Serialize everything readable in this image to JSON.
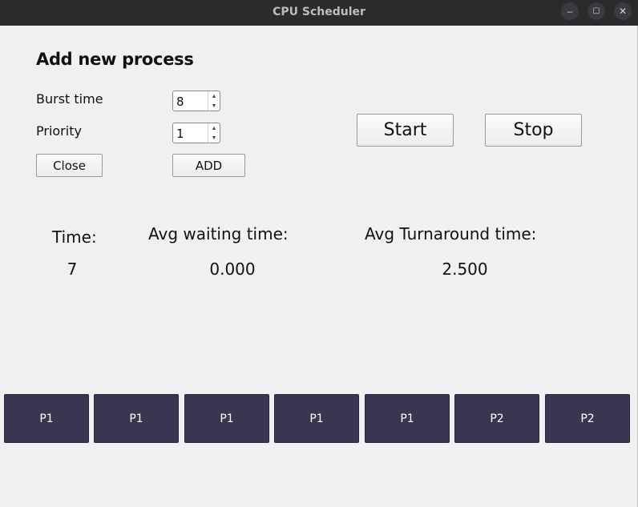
{
  "window": {
    "title": "CPU Scheduler",
    "controls": {
      "minimize": "–",
      "maximize": "▢",
      "close": "✕"
    }
  },
  "form": {
    "heading": "Add new process",
    "burst_label": "Burst time",
    "burst_value": "8",
    "priority_label": "Priority",
    "priority_value": "1",
    "close_label": "Close",
    "add_label": "ADD"
  },
  "controls": {
    "start_label": "Start",
    "stop_label": "Stop"
  },
  "stats": {
    "time_label": "Time:",
    "time_value": "7",
    "avg_wait_label": "Avg waiting time:",
    "avg_wait_value": "0.000",
    "avg_turn_label": "Avg Turnaround time:",
    "avg_turn_value": "2.500"
  },
  "gantt": [
    "P1",
    "P1",
    "P1",
    "P1",
    "P1",
    "P2",
    "P2"
  ],
  "colors": {
    "gantt_block": "#3b3551",
    "titlebar": "#2b2b2e",
    "background": "#f0f0f0"
  }
}
